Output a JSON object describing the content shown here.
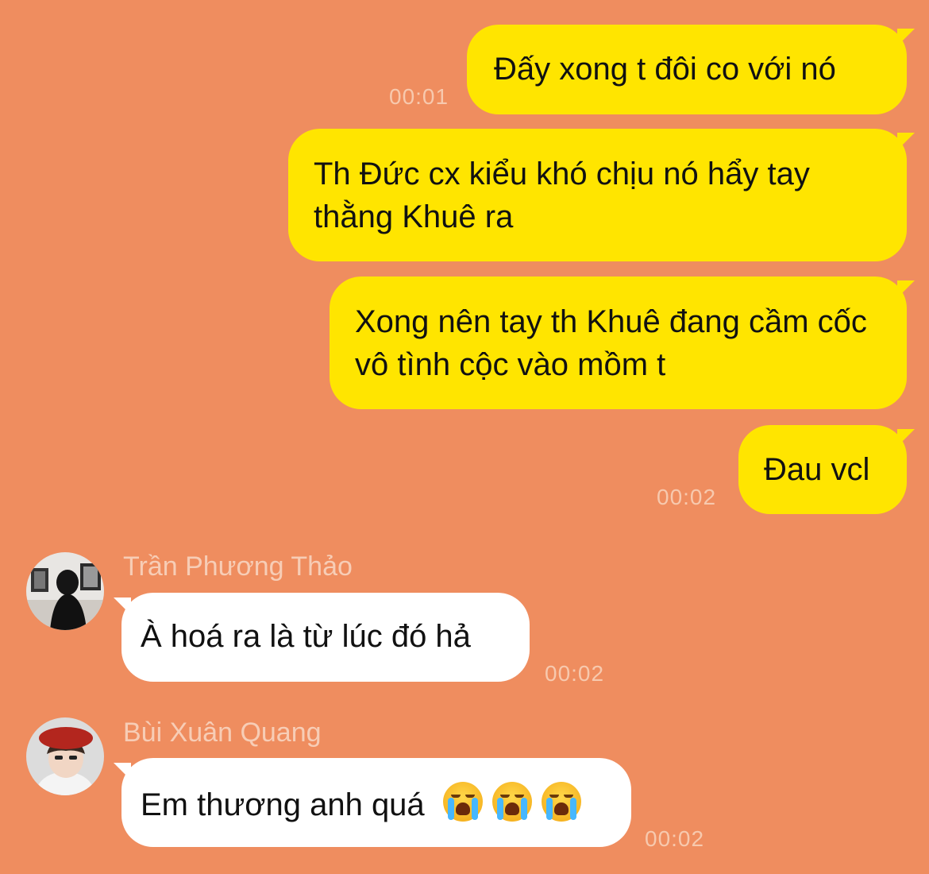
{
  "messages": [
    {
      "type": "outgoing",
      "text": "Đấy xong t đôi co với nó",
      "time": "00:01"
    },
    {
      "type": "outgoing",
      "text": "Th Đức cx kiểu khó chịu nó hẩy tay thằng Khuê ra"
    },
    {
      "type": "outgoing",
      "text": "Xong nên tay th Khuê đang cầm cốc vô tình cộc vào mồm t"
    },
    {
      "type": "outgoing",
      "text": "Đau vcl",
      "time": "00:02"
    },
    {
      "type": "incoming",
      "sender": "Trần Phương Thảo",
      "text": "À hoá ra là từ lúc đó hả",
      "time": "00:02"
    },
    {
      "type": "incoming",
      "sender": "Bùi Xuân Quang",
      "text": "Em thương anh quá",
      "emojis": [
        "loudly-crying-face",
        "loudly-crying-face",
        "loudly-crying-face"
      ],
      "time": "00:02"
    }
  ],
  "colors": {
    "background": "#ef8d5f",
    "outgoing_bubble": "#ffe500",
    "incoming_bubble": "#ffffff"
  }
}
